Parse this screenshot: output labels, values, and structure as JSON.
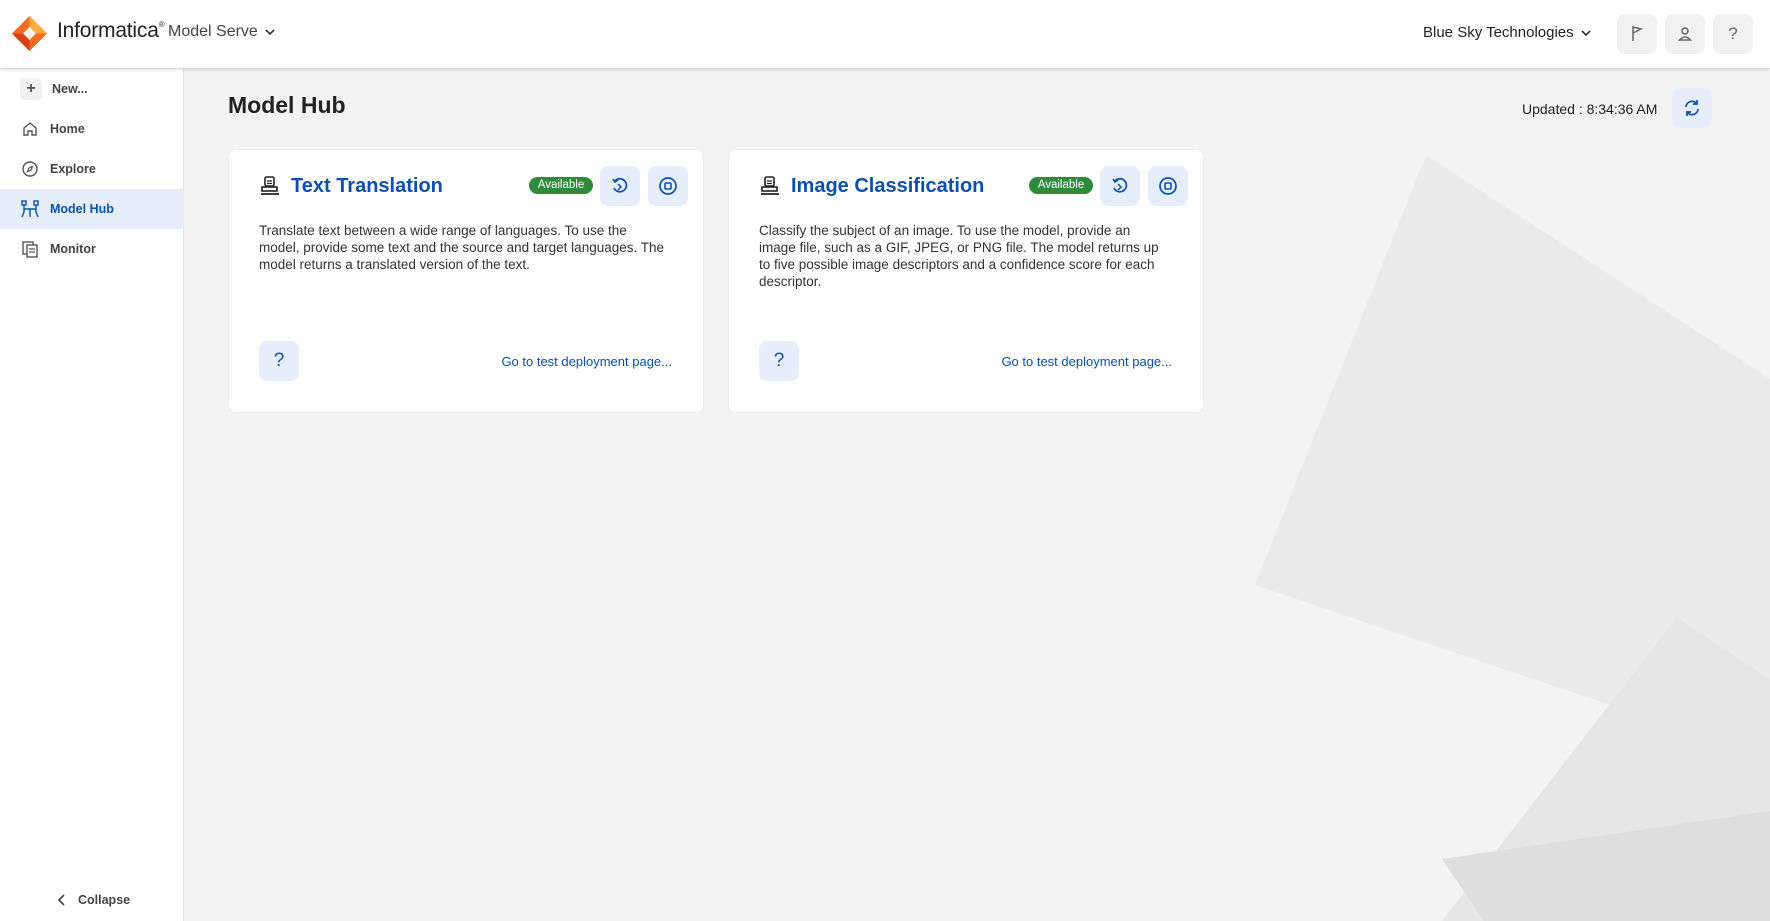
{
  "header": {
    "brand": "Informatica",
    "product": "Model Serve",
    "org": "Blue Sky Technologies",
    "icons": [
      "flag-icon",
      "user-icon",
      "help-icon"
    ]
  },
  "sidebar": {
    "items": [
      {
        "label": "New...",
        "icon": "plus-icon"
      },
      {
        "label": "Home",
        "icon": "home-icon"
      },
      {
        "label": "Explore",
        "icon": "compass-icon"
      },
      {
        "label": "Model Hub",
        "icon": "model-hub-icon",
        "active": true
      },
      {
        "label": "Monitor",
        "icon": "monitor-icon"
      }
    ],
    "collapse_label": "Collapse"
  },
  "main": {
    "title": "Model Hub",
    "updated": "Updated : 8:34:36 AM",
    "cards": [
      {
        "title": "Text Translation",
        "status": "Available",
        "description": "Translate text between a wide range of languages. To use the model, provide some text and the source and target languages. The model returns a translated version of the text.",
        "help": "?",
        "link": "Go to test deployment page..."
      },
      {
        "title": "Image Classification",
        "status": "Available",
        "description": "Classify the subject of an image. To use the model, provide an image file, such as a GIF, JPEG, or PNG file. The model returns up to five possible image descriptors and a confidence score for each descriptor.",
        "help": "?",
        "link": "Go to test deployment page..."
      }
    ]
  },
  "colors": {
    "accent": "#0b4fb3",
    "available": "#2e8b3a",
    "active_nav_bg": "#e6eefb"
  }
}
